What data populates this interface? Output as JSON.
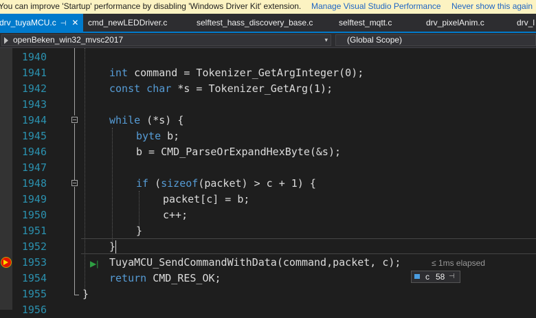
{
  "infobar": {
    "message": "You can improve 'Startup' performance by disabling 'Windows Driver Kit' extension.",
    "manage_link": "Manage Visual Studio Performance",
    "never_link": "Never show this again"
  },
  "tabs": [
    {
      "label": "drv_tuyaMCU.c",
      "pin": "⊣",
      "close": "✕"
    },
    {
      "label": "cmd_newLEDDriver.c"
    },
    {
      "label": "selftest_hass_discovery_base.c"
    },
    {
      "label": "selftest_mqtt.c"
    },
    {
      "label": "drv_pixelAnim.c"
    },
    {
      "label": "drv_l"
    }
  ],
  "nav": {
    "project": "openBeken_win32_mvsc2017",
    "scope": "(Global Scope)",
    "arrow": "▾"
  },
  "lines": {
    "n1940": "1940",
    "n1941": "1941",
    "n1942": "1942",
    "n1943": "1943",
    "n1944": "1944",
    "n1945": "1945",
    "n1946": "1946",
    "n1947": "1947",
    "n1948": "1948",
    "n1949": "1949",
    "n1950": "1950",
    "n1951": "1951",
    "n1952": "1952",
    "n1953": "1953",
    "n1954": "1954",
    "n1955": "1955",
    "n1956": "1956"
  },
  "code": {
    "l1941_kw": "int",
    "l1941_rest": " command = Tokenizer_GetArgInteger(0);",
    "l1942_kw": "const char",
    "l1942_rest": " *s = Tokenizer_GetArg(1);",
    "l1944_kw": "while",
    "l1944_rest": " (*s) {",
    "l1945_kw": "byte",
    "l1945_rest": " b;",
    "l1946": "b = CMD_ParseOrExpandHexByte(&s);",
    "l1948_kw1": "if",
    "l1948_mid": " (",
    "l1948_kw2": "sizeof",
    "l1948_rest": "(packet) > c + 1) {",
    "l1949": "packet[c] = b;",
    "l1950": "c++;",
    "l1951": "}",
    "l1952": "}",
    "l1953": "TuyaMCU_SendCommandWithData(command,packet, c);",
    "l1954_kw": "return",
    "l1954_rest": " CMD_RES_OK;",
    "l1955": "}"
  },
  "debug": {
    "run_icon": "▶|",
    "elapsed": "≤ 1ms elapsed",
    "datatip_name": "c",
    "datatip_value": "58",
    "datatip_pin": "⊣"
  },
  "colors": {
    "keyword": "#569cd6",
    "line_number": "#2b91af",
    "accent": "#007acc",
    "breakpoint": "#e51400"
  }
}
